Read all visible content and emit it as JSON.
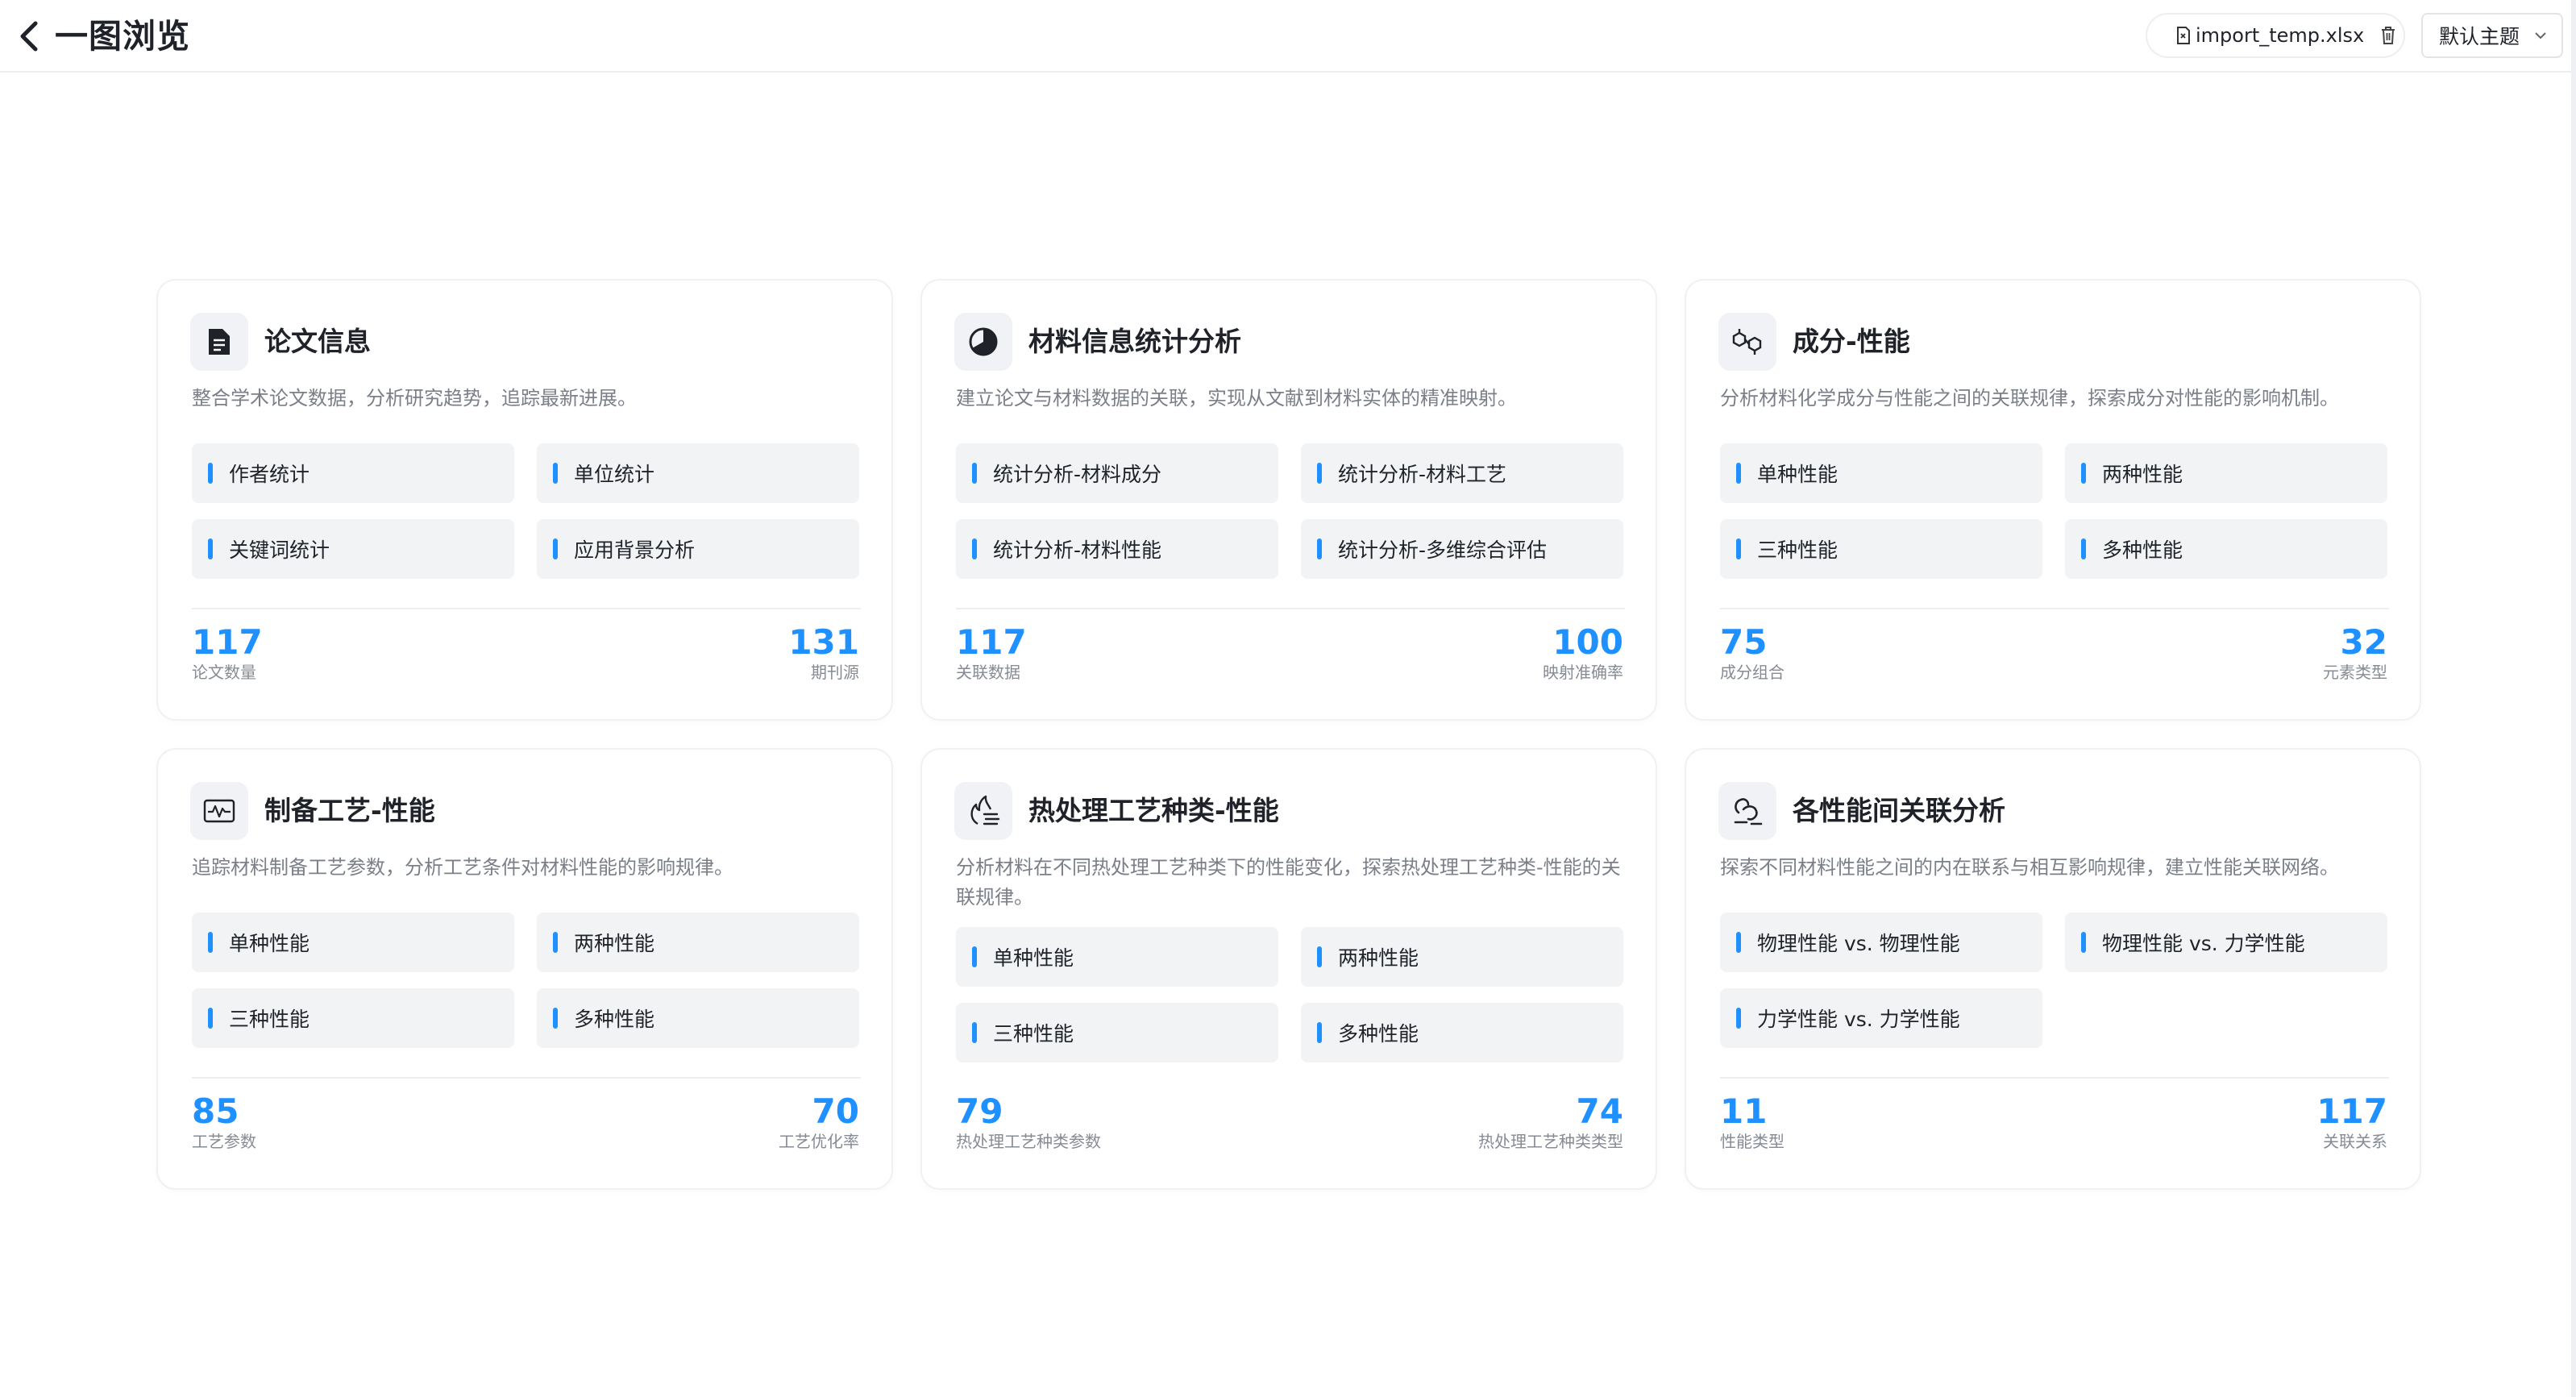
{
  "header": {
    "title": "一图浏览",
    "file_name": "import_temp.xlsx",
    "theme": "默认主题"
  },
  "cards": [
    {
      "icon": "document-icon",
      "title": "论文信息",
      "desc": "整合学术论文数据，分析研究趋势，追踪最新进展。",
      "chips": [
        "作者统计",
        "单位统计",
        "关键词统计",
        "应用背景分析"
      ],
      "stats": [
        {
          "value": "117",
          "label": "论文数量"
        },
        {
          "value": "131",
          "label": "期刊源"
        }
      ]
    },
    {
      "icon": "pie-chart-icon",
      "title": "材料信息统计分析",
      "desc": "建立论文与材料数据的关联，实现从文献到材料实体的精准映射。",
      "chips": [
        "统计分析-材料成分",
        "统计分析-材料工艺",
        "统计分析-材料性能",
        "统计分析-多维综合评估"
      ],
      "stats": [
        {
          "value": "117",
          "label": "关联数据"
        },
        {
          "value": "100",
          "label": "映射准确率"
        }
      ]
    },
    {
      "icon": "molecule-icon",
      "title": "成分-性能",
      "desc": "分析材料化学成分与性能之间的关联规律，探索成分对性能的影响机制。",
      "chips": [
        "单种性能",
        "两种性能",
        "三种性能",
        "多种性能"
      ],
      "stats": [
        {
          "value": "75",
          "label": "成分组合"
        },
        {
          "value": "32",
          "label": "元素类型"
        }
      ]
    },
    {
      "icon": "waveform-icon",
      "title": "制备工艺-性能",
      "desc": "追踪材料制备工艺参数，分析工艺条件对材料性能的影响规律。",
      "chips": [
        "单种性能",
        "两种性能",
        "三种性能",
        "多种性能"
      ],
      "stats": [
        {
          "value": "85",
          "label": "工艺参数"
        },
        {
          "value": "70",
          "label": "工艺优化率"
        }
      ]
    },
    {
      "icon": "heat-treatment-icon",
      "title": "热处理工艺种类-性能",
      "desc": "分析材料在不同热处理工艺种类下的性能变化，探索热处理工艺种类-性能的关联规律。",
      "chips": [
        "单种性能",
        "两种性能",
        "三种性能",
        "多种性能"
      ],
      "stats": [
        {
          "value": "79",
          "label": "热处理工艺种类参数"
        },
        {
          "value": "74",
          "label": "热处理工艺种类类型"
        }
      ]
    },
    {
      "icon": "link-icon",
      "title": "各性能间关联分析",
      "desc": "探索不同材料性能之间的内在联系与相互影响规律，建立性能关联网络。",
      "chips": [
        "物理性能 vs. 物理性能",
        "物理性能 vs. 力学性能",
        "力学性能 vs. 力学性能"
      ],
      "stats": [
        {
          "value": "11",
          "label": "性能类型"
        },
        {
          "value": "117",
          "label": "关联关系"
        }
      ]
    }
  ],
  "colors": {
    "accent": "#1e90ff",
    "chip_bg": "#f2f3f5",
    "icon_bg": "#f1f2f5"
  }
}
